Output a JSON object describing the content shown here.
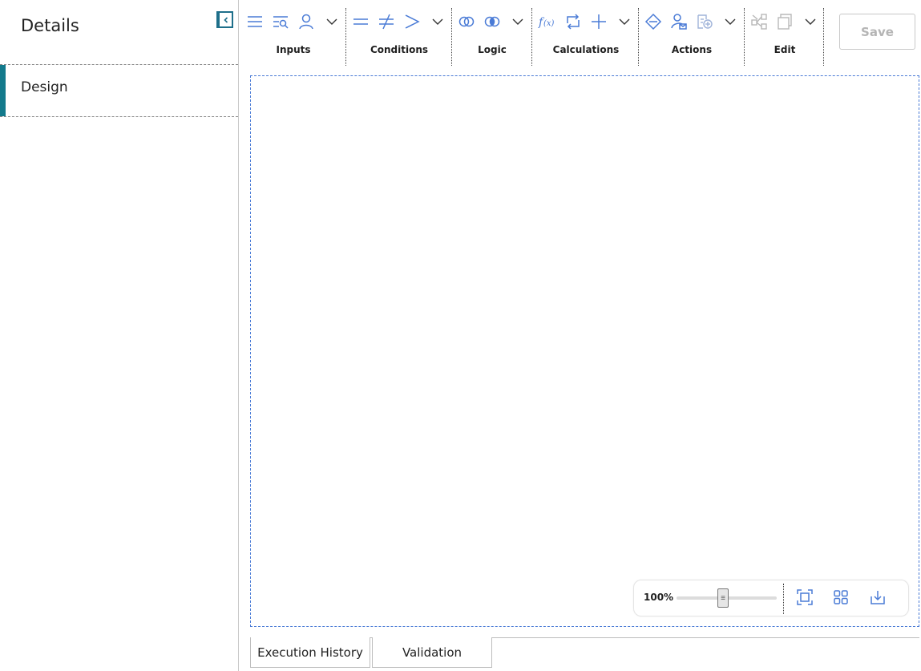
{
  "sidebar": {
    "title": "Details",
    "items": [
      {
        "label": "Design",
        "active": true
      }
    ]
  },
  "toolbar": {
    "groups": [
      {
        "label": "Inputs",
        "icons": [
          "list-icon",
          "search-list-icon",
          "user-icon",
          "chevron-down-icon"
        ]
      },
      {
        "label": "Conditions",
        "icons": [
          "equals-icon",
          "not-equal-icon",
          "greater-than-icon",
          "chevron-down-icon"
        ]
      },
      {
        "label": "Logic",
        "icons": [
          "or-circles-icon",
          "and-circles-icon",
          "chevron-down-icon"
        ]
      },
      {
        "label": "Calculations",
        "icons": [
          "function-icon",
          "loop-icon",
          "plus-icon",
          "chevron-down-icon"
        ]
      },
      {
        "label": "Actions",
        "icons": [
          "diamond-icon",
          "user-action-icon",
          "add-record-icon",
          "chevron-down-icon"
        ]
      },
      {
        "label": "Edit",
        "icons": [
          "disconnect-icon",
          "copy-icon",
          "chevron-down-icon"
        ]
      }
    ],
    "save_label": "Save",
    "save_enabled": false
  },
  "canvas": {
    "zoom": {
      "label": "100%",
      "value_percent": 100
    },
    "tools": [
      "fit-screen-icon",
      "grid-layout-icon",
      "download-icon"
    ]
  },
  "bottom_tabs": [
    {
      "label": "Execution History"
    },
    {
      "label": "Validation"
    }
  ],
  "colors": {
    "accent": "#137a8c",
    "icon_blue": "#4a7bd6",
    "disabled_text": "#b5b5b5"
  }
}
